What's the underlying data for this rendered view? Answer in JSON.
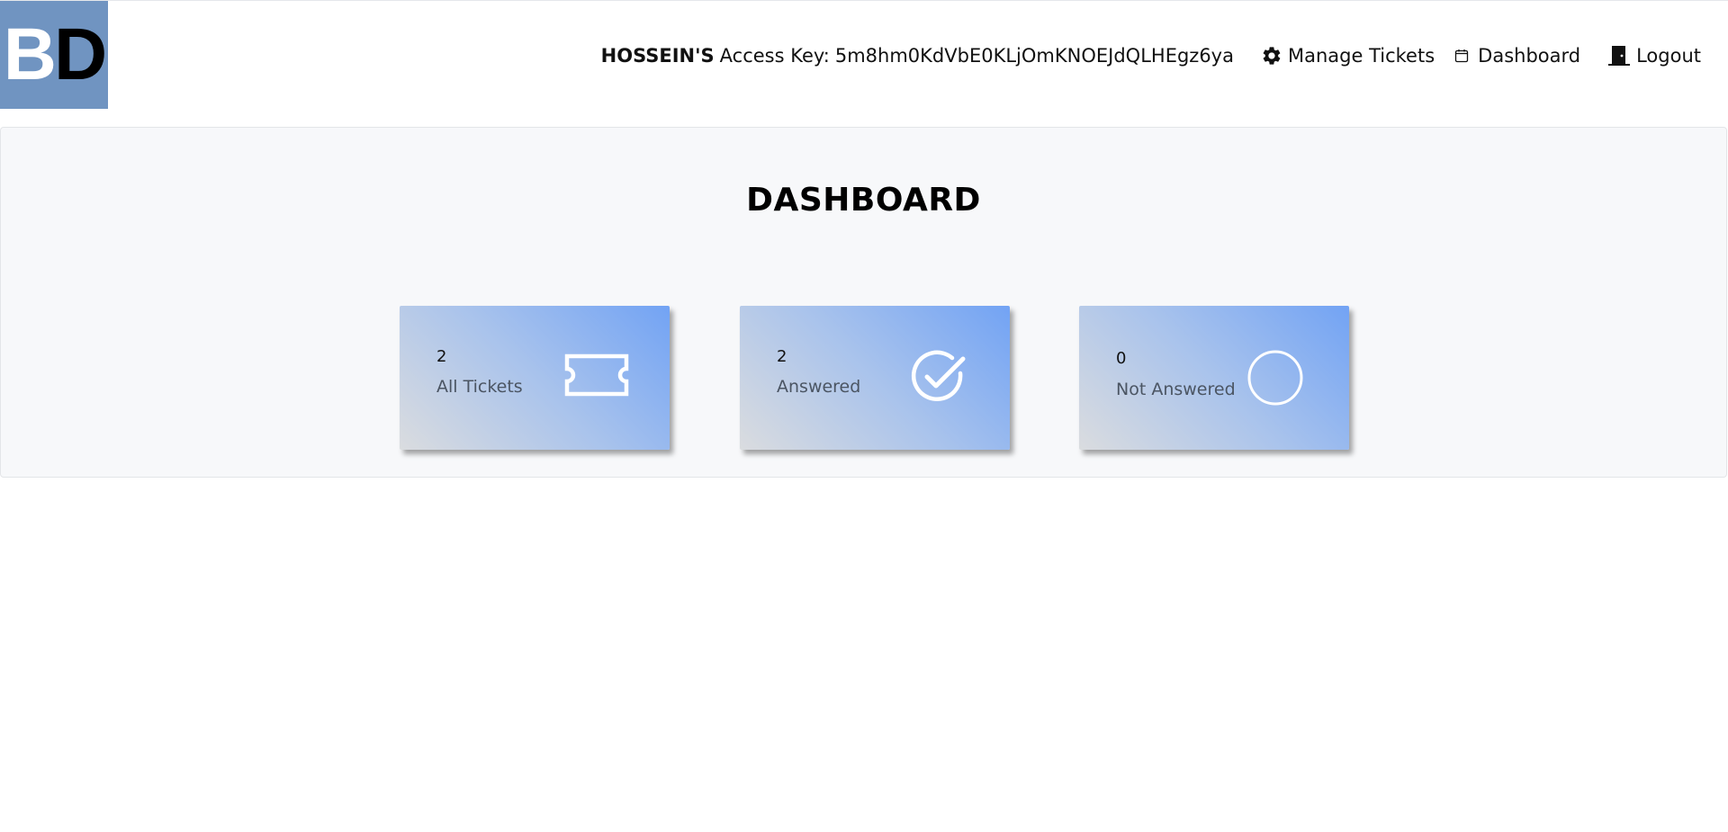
{
  "brand": {
    "logo_text_1": "B",
    "logo_text_2": "D",
    "logo_color": "#7094c1"
  },
  "header": {
    "user_name": "HOSSEIN'S",
    "access_label": "Access Key:",
    "access_key": "5m8hm0KdVbE0KLjOmKNOEJdQLHEgz6ya",
    "nav": [
      {
        "label": "Manage Tickets",
        "icon": "gear-icon"
      },
      {
        "label": "Dashboard",
        "icon": "calendar-icon"
      },
      {
        "label": "Logout",
        "icon": "door-icon"
      }
    ]
  },
  "main": {
    "title": "DASHBOARD",
    "cards": [
      {
        "count": "2",
        "label": "All Tickets",
        "icon": "ticket-icon"
      },
      {
        "count": "2",
        "label": "Answered",
        "icon": "check-circle-icon"
      },
      {
        "count": "0",
        "label": "Not Answered",
        "icon": "circle-icon"
      }
    ],
    "card_gradient": [
      "#72a3f4",
      "#a9c3ec",
      "#dadcdf"
    ]
  }
}
